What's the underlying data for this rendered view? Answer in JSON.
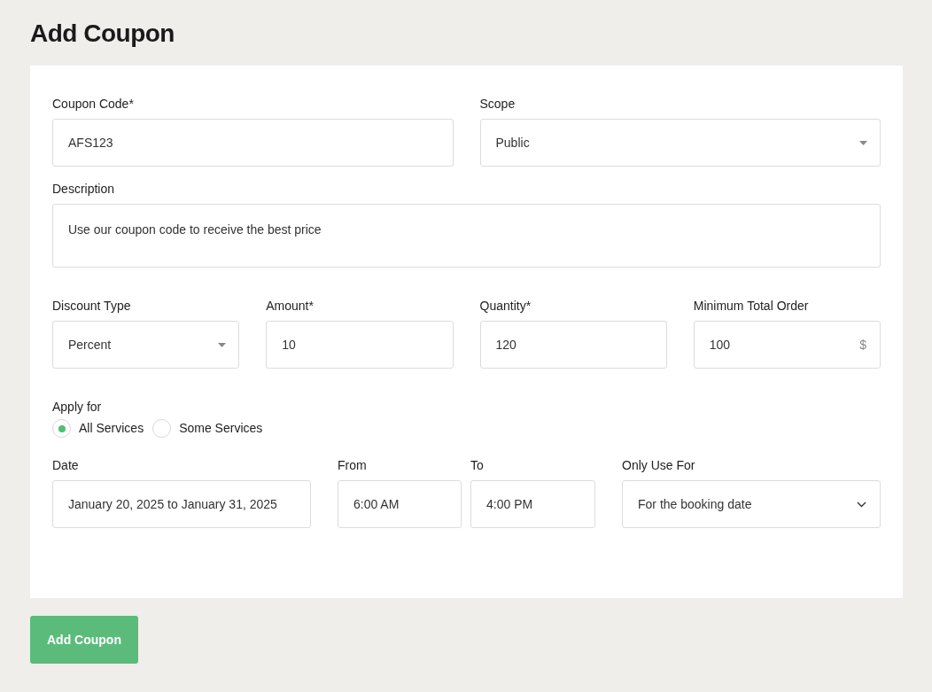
{
  "page_title": "Add Coupon",
  "coupon_code": {
    "label": "Coupon Code*",
    "value": "AFS123"
  },
  "scope": {
    "label": "Scope",
    "value": "Public"
  },
  "description": {
    "label": "Description",
    "value": "Use our coupon code to receive the best price"
  },
  "discount_type": {
    "label": "Discount Type",
    "value": "Percent"
  },
  "amount": {
    "label": "Amount*",
    "value": "10"
  },
  "quantity": {
    "label": "Quantity*",
    "value": "120"
  },
  "minimum_total_order": {
    "label": "Minimum Total Order",
    "value": "100",
    "suffix": "$"
  },
  "apply_for": {
    "label": "Apply for",
    "options": [
      {
        "label": "All Services",
        "selected": true
      },
      {
        "label": "Some Services",
        "selected": false
      }
    ]
  },
  "date": {
    "label": "Date",
    "value": "January 20, 2025 to January 31, 2025"
  },
  "from": {
    "label": "From",
    "value": "6:00 AM"
  },
  "to": {
    "label": "To",
    "value": "4:00 PM"
  },
  "only_use_for": {
    "label": "Only Use For",
    "value": "For the booking date"
  },
  "submit_button": "Add Coupon"
}
